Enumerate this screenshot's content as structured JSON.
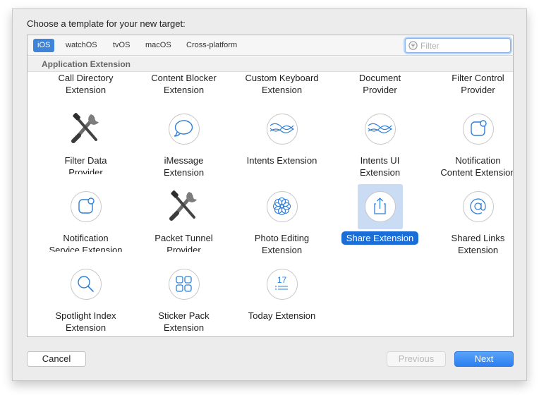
{
  "dialog": {
    "prompt": "Choose a template for your new target:"
  },
  "platform_tabs": [
    {
      "label": "iOS",
      "selected": true
    },
    {
      "label": "watchOS",
      "selected": false
    },
    {
      "label": "tvOS",
      "selected": false
    },
    {
      "label": "macOS",
      "selected": false
    },
    {
      "label": "Cross-platform",
      "selected": false
    }
  ],
  "filter": {
    "placeholder": "Filter",
    "value": ""
  },
  "section": {
    "title": "Application Extension"
  },
  "top_labels": [
    "Call Directory\nExtension",
    "Content Blocker\nExtension",
    "Custom Keyboard\nExtension",
    "Document\nProvider",
    "Filter Control\nProvider\nExtension"
  ],
  "templates": [
    {
      "label": "Filter Data\nProvider\nExtension",
      "icon": "tools-icon"
    },
    {
      "label": "iMessage\nExtension",
      "icon": "speech-bubble-icon"
    },
    {
      "label": "Intents Extension",
      "icon": "intents-waves-icon"
    },
    {
      "label": "Intents UI\nExtension",
      "icon": "intents-ui-waves-icon"
    },
    {
      "label": "Notification\nContent Extension",
      "icon": "notification-content-icon"
    },
    {
      "label": "Notification\nService Extension",
      "icon": "notification-service-icon"
    },
    {
      "label": "Packet Tunnel\nProvider\nExtension",
      "icon": "tools-icon"
    },
    {
      "label": "Photo Editing\nExtension",
      "icon": "photo-flower-icon"
    },
    {
      "label": "Share Extension",
      "icon": "share-icon",
      "selected": true
    },
    {
      "label": "Shared Links\nExtension",
      "icon": "at-sign-icon"
    },
    {
      "label": "Spotlight Index\nExtension",
      "icon": "magnifier-icon"
    },
    {
      "label": "Sticker Pack\nExtension",
      "icon": "sticker-grid-icon"
    },
    {
      "label": "Today Extension",
      "icon": "calendar-today-icon",
      "calendar_day": "17"
    }
  ],
  "buttons": {
    "cancel": "Cancel",
    "previous": "Previous",
    "next": "Next"
  },
  "colors": {
    "selection": "#1b6ed7",
    "accent": "#3e84d9"
  }
}
